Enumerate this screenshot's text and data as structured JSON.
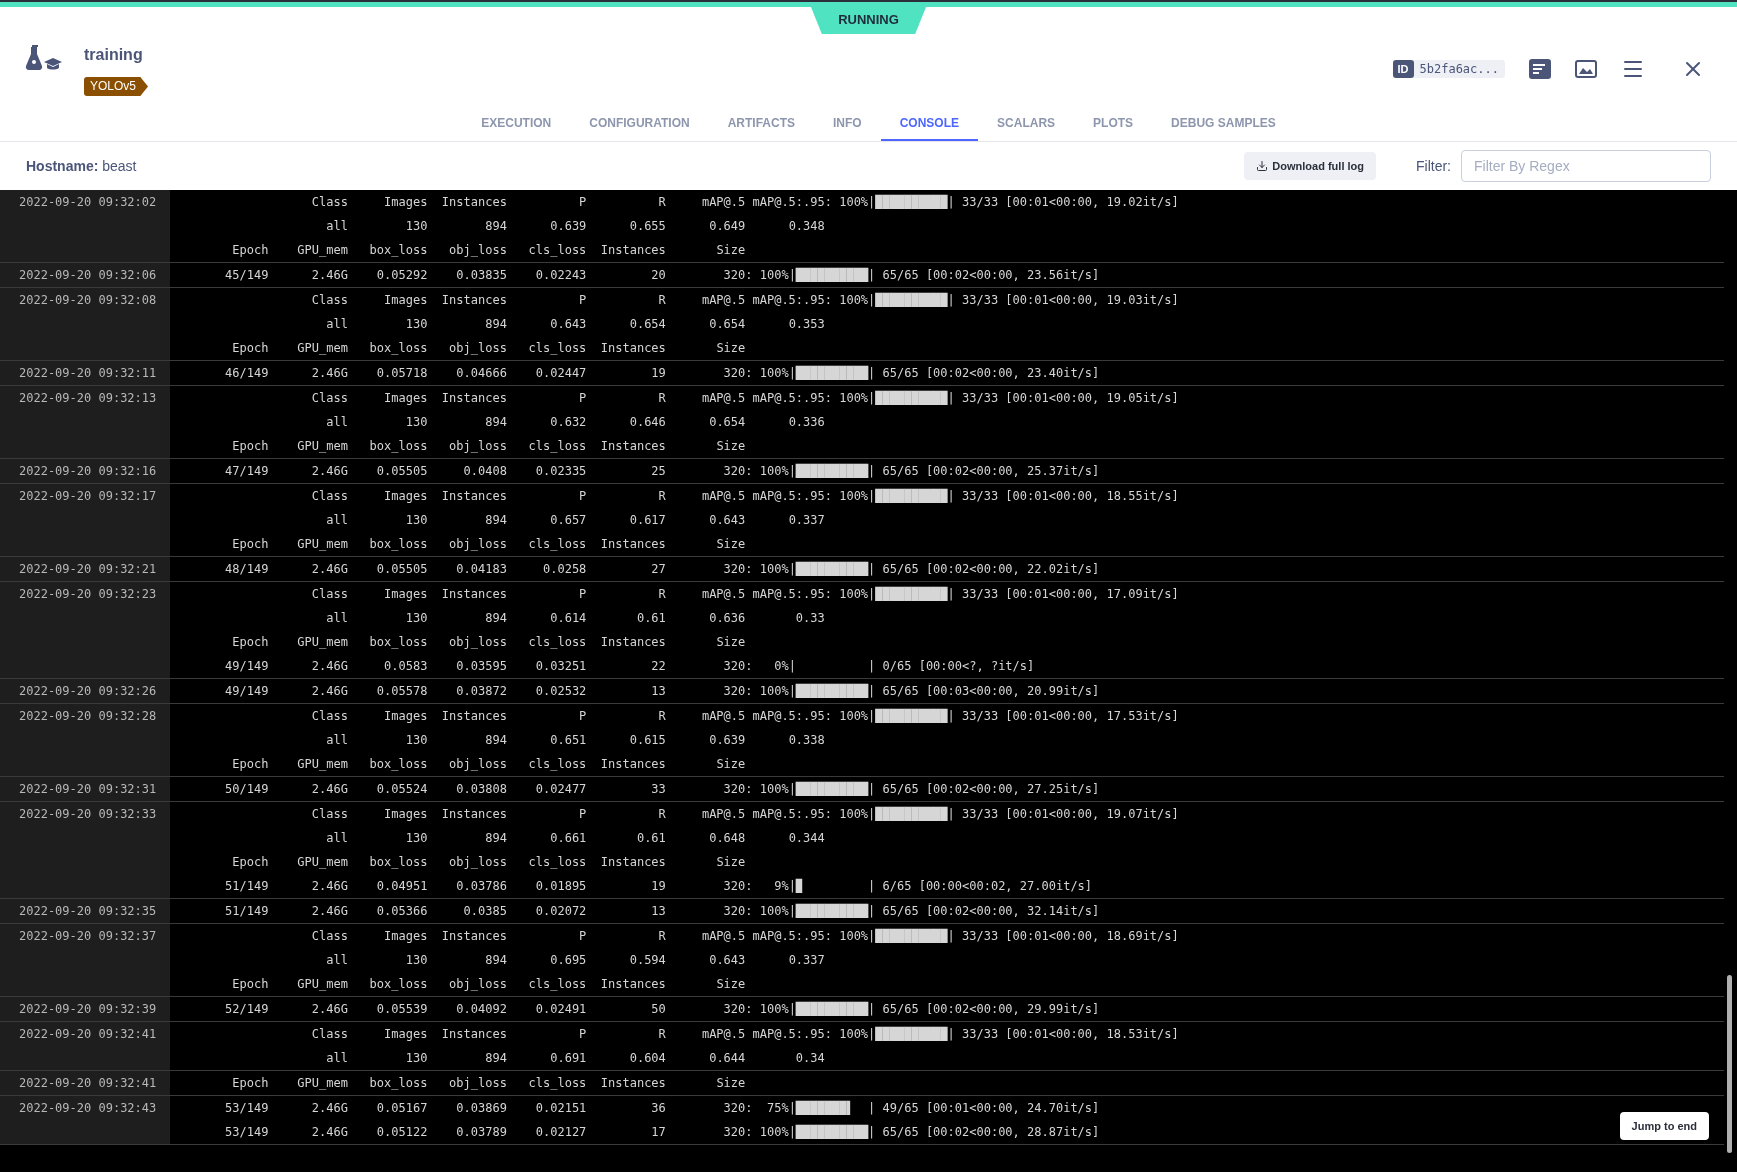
{
  "status": "RUNNING",
  "experiment": {
    "name": "training",
    "tag": "YOLOv5"
  },
  "id_badge": {
    "label": "ID",
    "value": "5b2fa6ac..."
  },
  "tabs": [
    {
      "label": "EXECUTION",
      "selected": false
    },
    {
      "label": "CONFIGURATION",
      "selected": false
    },
    {
      "label": "ARTIFACTS",
      "selected": false
    },
    {
      "label": "INFO",
      "selected": false
    },
    {
      "label": "CONSOLE",
      "selected": true
    },
    {
      "label": "SCALARS",
      "selected": false
    },
    {
      "label": "PLOTS",
      "selected": false
    },
    {
      "label": "DEBUG SAMPLES",
      "selected": false
    }
  ],
  "hostname": "**Hostname:** beast",
  "download_button": "Download full log",
  "filter": {
    "label": "Filter:",
    "placeholder": "Filter By Regex"
  },
  "log": [
    {
      "time": "2022-09-20 09:32:02",
      "lines": [
        {
          "kind": "val",
          "cells": [
            "Class",
            "Images",
            "Instances",
            "P",
            "R",
            "mAP@.5",
            "mAP@.5:.95"
          ],
          "tail": ": 100%|██████████| 33/33 [00:01<00:00, 19.02it/s]"
        },
        {
          "kind": "val",
          "cells": [
            "all",
            "130",
            "894",
            "0.639",
            "0.655",
            "0.649",
            "0.348"
          ]
        },
        {
          "kind": "train",
          "cells": [
            "Epoch",
            "GPU_mem",
            "box_loss",
            "obj_loss",
            "cls_loss",
            "Instances",
            "Size"
          ]
        }
      ]
    },
    {
      "time": "2022-09-20 09:32:06",
      "lines": [
        {
          "kind": "train",
          "cells": [
            "45/149",
            "2.46G",
            "0.05292",
            "0.03835",
            "0.02243",
            "20",
            "320"
          ],
          "tail": ": 100%|██████████| 65/65 [00:02<00:00, 23.56it/s]"
        }
      ]
    },
    {
      "time": "2022-09-20 09:32:08",
      "lines": [
        {
          "kind": "val",
          "cells": [
            "Class",
            "Images",
            "Instances",
            "P",
            "R",
            "mAP@.5",
            "mAP@.5:.95"
          ],
          "tail": ": 100%|██████████| 33/33 [00:01<00:00, 19.03it/s]"
        },
        {
          "kind": "val",
          "cells": [
            "all",
            "130",
            "894",
            "0.643",
            "0.654",
            "0.654",
            "0.353"
          ]
        },
        {
          "kind": "train",
          "cells": [
            "Epoch",
            "GPU_mem",
            "box_loss",
            "obj_loss",
            "cls_loss",
            "Instances",
            "Size"
          ]
        }
      ]
    },
    {
      "time": "2022-09-20 09:32:11",
      "lines": [
        {
          "kind": "train",
          "cells": [
            "46/149",
            "2.46G",
            "0.05718",
            "0.04666",
            "0.02447",
            "19",
            "320"
          ],
          "tail": ": 100%|██████████| 65/65 [00:02<00:00, 23.40it/s]"
        }
      ]
    },
    {
      "time": "2022-09-20 09:32:13",
      "lines": [
        {
          "kind": "val",
          "cells": [
            "Class",
            "Images",
            "Instances",
            "P",
            "R",
            "mAP@.5",
            "mAP@.5:.95"
          ],
          "tail": ": 100%|██████████| 33/33 [00:01<00:00, 19.05it/s]"
        },
        {
          "kind": "val",
          "cells": [
            "all",
            "130",
            "894",
            "0.632",
            "0.646",
            "0.654",
            "0.336"
          ]
        },
        {
          "kind": "train",
          "cells": [
            "Epoch",
            "GPU_mem",
            "box_loss",
            "obj_loss",
            "cls_loss",
            "Instances",
            "Size"
          ]
        }
      ]
    },
    {
      "time": "2022-09-20 09:32:16",
      "lines": [
        {
          "kind": "train",
          "cells": [
            "47/149",
            "2.46G",
            "0.05505",
            "0.0408",
            "0.02335",
            "25",
            "320"
          ],
          "tail": ": 100%|██████████| 65/65 [00:02<00:00, 25.37it/s]"
        }
      ]
    },
    {
      "time": "2022-09-20 09:32:17",
      "lines": [
        {
          "kind": "val",
          "cells": [
            "Class",
            "Images",
            "Instances",
            "P",
            "R",
            "mAP@.5",
            "mAP@.5:.95"
          ],
          "tail": ": 100%|██████████| 33/33 [00:01<00:00, 18.55it/s]"
        },
        {
          "kind": "val",
          "cells": [
            "all",
            "130",
            "894",
            "0.657",
            "0.617",
            "0.643",
            "0.337"
          ]
        },
        {
          "kind": "train",
          "cells": [
            "Epoch",
            "GPU_mem",
            "box_loss",
            "obj_loss",
            "cls_loss",
            "Instances",
            "Size"
          ]
        }
      ]
    },
    {
      "time": "2022-09-20 09:32:21",
      "lines": [
        {
          "kind": "train",
          "cells": [
            "48/149",
            "2.46G",
            "0.05505",
            "0.04183",
            "0.0258",
            "27",
            "320"
          ],
          "tail": ": 100%|██████████| 65/65 [00:02<00:00, 22.02it/s]"
        }
      ]
    },
    {
      "time": "2022-09-20 09:32:23",
      "lines": [
        {
          "kind": "val",
          "cells": [
            "Class",
            "Images",
            "Instances",
            "P",
            "R",
            "mAP@.5",
            "mAP@.5:.95"
          ],
          "tail": ": 100%|██████████| 33/33 [00:01<00:00, 17.09it/s]"
        },
        {
          "kind": "val",
          "cells": [
            "all",
            "130",
            "894",
            "0.614",
            "0.61",
            "0.636",
            "0.33"
          ]
        },
        {
          "kind": "train",
          "cells": [
            "Epoch",
            "GPU_mem",
            "box_loss",
            "obj_loss",
            "cls_loss",
            "Instances",
            "Size"
          ]
        },
        {
          "kind": "train",
          "cells": [
            "49/149",
            "2.46G",
            "0.0583",
            "0.03595",
            "0.03251",
            "22",
            "320"
          ],
          "tail": ":   0%|          | 0/65 [00:00<?, ?it/s]"
        }
      ]
    },
    {
      "time": "2022-09-20 09:32:26",
      "lines": [
        {
          "kind": "train",
          "cells": [
            "49/149",
            "2.46G",
            "0.05578",
            "0.03872",
            "0.02532",
            "13",
            "320"
          ],
          "tail": ": 100%|██████████| 65/65 [00:03<00:00, 20.99it/s]"
        }
      ]
    },
    {
      "time": "2022-09-20 09:32:28",
      "lines": [
        {
          "kind": "val",
          "cells": [
            "Class",
            "Images",
            "Instances",
            "P",
            "R",
            "mAP@.5",
            "mAP@.5:.95"
          ],
          "tail": ": 100%|██████████| 33/33 [00:01<00:00, 17.53it/s]"
        },
        {
          "kind": "val",
          "cells": [
            "all",
            "130",
            "894",
            "0.651",
            "0.615",
            "0.639",
            "0.338"
          ]
        },
        {
          "kind": "train",
          "cells": [
            "Epoch",
            "GPU_mem",
            "box_loss",
            "obj_loss",
            "cls_loss",
            "Instances",
            "Size"
          ]
        }
      ]
    },
    {
      "time": "2022-09-20 09:32:31",
      "lines": [
        {
          "kind": "train",
          "cells": [
            "50/149",
            "2.46G",
            "0.05524",
            "0.03808",
            "0.02477",
            "33",
            "320"
          ],
          "tail": ": 100%|██████████| 65/65 [00:02<00:00, 27.25it/s]"
        }
      ]
    },
    {
      "time": "2022-09-20 09:32:33",
      "lines": [
        {
          "kind": "val",
          "cells": [
            "Class",
            "Images",
            "Instances",
            "P",
            "R",
            "mAP@.5",
            "mAP@.5:.95"
          ],
          "tail": ": 100%|██████████| 33/33 [00:01<00:00, 19.07it/s]"
        },
        {
          "kind": "val",
          "cells": [
            "all",
            "130",
            "894",
            "0.661",
            "0.61",
            "0.648",
            "0.344"
          ]
        },
        {
          "kind": "train",
          "cells": [
            "Epoch",
            "GPU_mem",
            "box_loss",
            "obj_loss",
            "cls_loss",
            "Instances",
            "Size"
          ]
        },
        {
          "kind": "train",
          "cells": [
            "51/149",
            "2.46G",
            "0.04951",
            "0.03786",
            "0.01895",
            "19",
            "320"
          ],
          "tail": ":   9%|▉         | 6/65 [00:00<00:02, 27.00it/s]"
        }
      ]
    },
    {
      "time": "2022-09-20 09:32:35",
      "lines": [
        {
          "kind": "train",
          "cells": [
            "51/149",
            "2.46G",
            "0.05366",
            "0.0385",
            "0.02072",
            "13",
            "320"
          ],
          "tail": ": 100%|██████████| 65/65 [00:02<00:00, 32.14it/s]"
        }
      ]
    },
    {
      "time": "2022-09-20 09:32:37",
      "lines": [
        {
          "kind": "val",
          "cells": [
            "Class",
            "Images",
            "Instances",
            "P",
            "R",
            "mAP@.5",
            "mAP@.5:.95"
          ],
          "tail": ": 100%|██████████| 33/33 [00:01<00:00, 18.69it/s]"
        },
        {
          "kind": "val",
          "cells": [
            "all",
            "130",
            "894",
            "0.695",
            "0.594",
            "0.643",
            "0.337"
          ]
        },
        {
          "kind": "train",
          "cells": [
            "Epoch",
            "GPU_mem",
            "box_loss",
            "obj_loss",
            "cls_loss",
            "Instances",
            "Size"
          ]
        }
      ]
    },
    {
      "time": "2022-09-20 09:32:39",
      "lines": [
        {
          "kind": "train",
          "cells": [
            "52/149",
            "2.46G",
            "0.05539",
            "0.04092",
            "0.02491",
            "50",
            "320"
          ],
          "tail": ": 100%|██████████| 65/65 [00:02<00:00, 29.99it/s]"
        }
      ]
    },
    {
      "time": "2022-09-20 09:32:41",
      "lines": [
        {
          "kind": "val",
          "cells": [
            "Class",
            "Images",
            "Instances",
            "P",
            "R",
            "mAP@.5",
            "mAP@.5:.95"
          ],
          "tail": ": 100%|██████████| 33/33 [00:01<00:00, 18.53it/s]"
        },
        {
          "kind": "val",
          "cells": [
            "all",
            "130",
            "894",
            "0.691",
            "0.604",
            "0.644",
            "0.34"
          ]
        }
      ]
    },
    {
      "time": "2022-09-20 09:32:41",
      "lines": [
        {
          "kind": "train",
          "cells": [
            "Epoch",
            "GPU_mem",
            "box_loss",
            "obj_loss",
            "cls_loss",
            "Instances",
            "Size"
          ]
        }
      ]
    },
    {
      "time": "2022-09-20 09:32:43",
      "lines": [
        {
          "kind": "train",
          "cells": [
            "53/149",
            "2.46G",
            "0.05167",
            "0.03869",
            "0.02151",
            "36",
            "320"
          ],
          "tail": ":  75%|███████▌  | 49/65 [00:01<00:00, 24.70it/s]"
        },
        {
          "kind": "train",
          "cells": [
            "53/149",
            "2.46G",
            "0.05122",
            "0.03789",
            "0.02127",
            "17",
            "320"
          ],
          "tail": ": 100%|██████████| 65/65 [00:02<00:00, 28.87it/s]"
        }
      ]
    }
  ],
  "jump_button": "Jump to end"
}
